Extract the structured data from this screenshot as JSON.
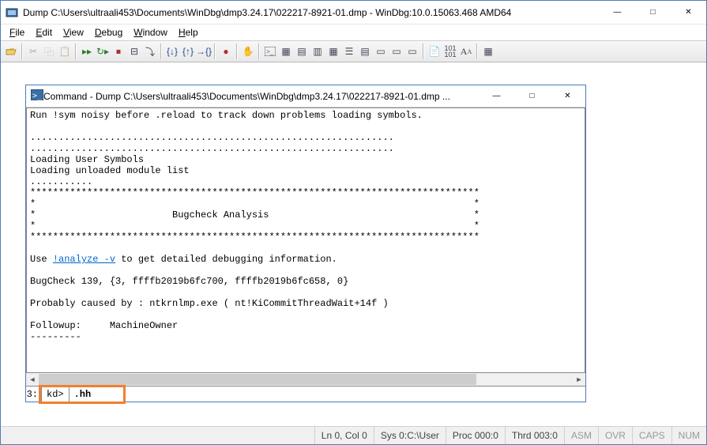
{
  "window": {
    "title": "Dump C:\\Users\\ultraali453\\Documents\\WinDbg\\dmp3.24.17\\022217-8921-01.dmp - WinDbg:10.0.15063.468 AMD64"
  },
  "menu": {
    "file": "File",
    "edit": "Edit",
    "view": "View",
    "debug": "Debug",
    "window": "Window",
    "help": "Help"
  },
  "cmd_window": {
    "title": "Command - Dump C:\\Users\\ultraali453\\Documents\\WinDbg\\dmp3.24.17\\022217-8921-01.dmp ..."
  },
  "cmd_output": {
    "line1": "Run !sym noisy before .reload to track down problems loading symbols.",
    "blank1": "",
    "dots1": "................................................................",
    "dots2": "................................................................",
    "load_user": "Loading User Symbols",
    "load_unloaded": "Loading unloaded module list",
    "dots3": "...........",
    "stars1": "*******************************************************************************",
    "star_blank1": "*                                                                             *",
    "star_title": "*                        Bugcheck Analysis                                    *",
    "star_blank2": "*                                                                             *",
    "stars2": "*******************************************************************************",
    "blank2": "",
    "use_pre": "Use ",
    "use_link": "!analyze -v",
    "use_post": " to get detailed debugging information.",
    "blank3": "",
    "bugcheck": "BugCheck 139, {3, ffffb2019b6fc700, ffffb2019b6fc658, 0}",
    "blank4": "",
    "probably": "Probably caused by : ntkrnlmp.exe ( nt!KiCommitThreadWait+14f )",
    "blank5": "",
    "followup": "Followup:     MachineOwner",
    "dashes": "---------"
  },
  "cmd_input": {
    "num": "3:",
    "prompt": "kd>",
    "value": ".hh"
  },
  "status": {
    "ln_col": "Ln 0, Col 0",
    "sys": "Sys 0:C:\\User",
    "proc": "Proc 000:0",
    "thrd": "Thrd 003:0",
    "asm": "ASM",
    "ovr": "OVR",
    "caps": "CAPS",
    "num": "NUM"
  }
}
